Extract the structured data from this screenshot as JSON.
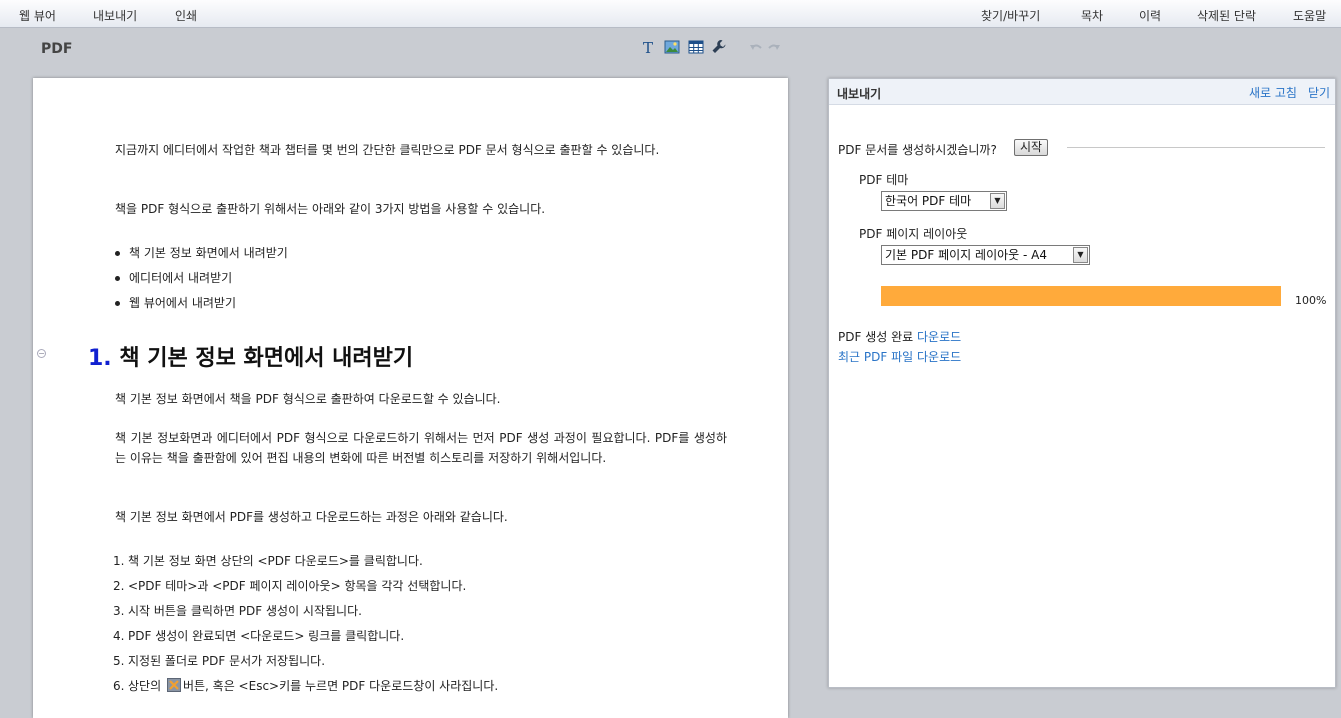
{
  "menu": {
    "left": [
      "웹 뷰어",
      "내보내기",
      "인쇄"
    ],
    "right": [
      "찾기/바꾸기",
      "목차",
      "이력",
      "삭제된 단락",
      "도움말"
    ]
  },
  "toolbar": {
    "title": "PDF",
    "icons": [
      "text-icon",
      "image-icon",
      "table-icon",
      "wrench-icon",
      "undo-icon",
      "redo-icon"
    ]
  },
  "document": {
    "intro": "지금까지 에디터에서 작업한 책과 챕터를 몇 번의 간단한 클릭만으로 PDF 문서 형식으로 출판할 수 있습니다.",
    "methods_intro": "책을 PDF 형식으로 출판하기 위해서는 아래와 같이 3가지 방법을 사용할 수 있습니다.",
    "bullets": [
      "책 기본 정보 화면에서 내려받기",
      "에디터에서 내려받기",
      "웹 뷰어에서 내려받기"
    ],
    "heading_number": "1.",
    "heading_text": "책 기본 정보 화면에서 내려받기",
    "para1": "책 기본 정보 화면에서 책을 PDF 형식으로 출판하여 다운로드할 수 있습니다.",
    "para2": "책 기본 정보화면과 에디터에서 PDF 형식으로 다운로드하기 위해서는 먼저 PDF 생성 과정이 필요합니다. PDF를 생성하는 이유는 책을 출판함에 있어 편집 내용의 변화에 따른 버전별 히스토리를 저장하기 위해서입니다.",
    "para3": "책 기본 정보 화면에서 PDF를 생성하고 다운로드하는 과정은 아래와 같습니다.",
    "steps": [
      {
        "n": "1.",
        "text": "책 기본 정보 화면 상단의 <PDF 다운로드>를 클릭합니다."
      },
      {
        "n": "2.",
        "text": "<PDF 테마>과 <PDF 페이지 레이아웃> 항목을 각각 선택합니다."
      },
      {
        "n": "3.",
        "text": "시작 버튼을 클릭하면 PDF 생성이 시작됩니다."
      },
      {
        "n": "4.",
        "text": "PDF 생성이 완료되면 <다운로드> 링크를 클릭합니다."
      },
      {
        "n": "5.",
        "text": "지정된 폴더로 PDF 문서가 저장됩니다."
      },
      {
        "n": "6.",
        "text_before": "상단의",
        "text_after": "버튼, 혹은 <Esc>키를 누르면 PDF 다운로드창이 사라집니다."
      }
    ]
  },
  "export_panel": {
    "title": "내보내기",
    "refresh": "새로 고침",
    "close": "닫기",
    "question": "PDF 문서를 생성하시겠습니까?",
    "start_button": "시작",
    "theme_label": "PDF 테마",
    "theme_value": "한국어 PDF 테마",
    "layout_label": "PDF 페이지 레이아웃",
    "layout_value": "기본 PDF 페이지 레이아웃 - A4",
    "progress": 1.0,
    "progress_text": "100%",
    "done_text": "PDF 생성 완료",
    "download_link": "다운로드",
    "recent_link": "최근 PDF 파일 다운로드",
    "progress_color": "#ffaa3b"
  }
}
